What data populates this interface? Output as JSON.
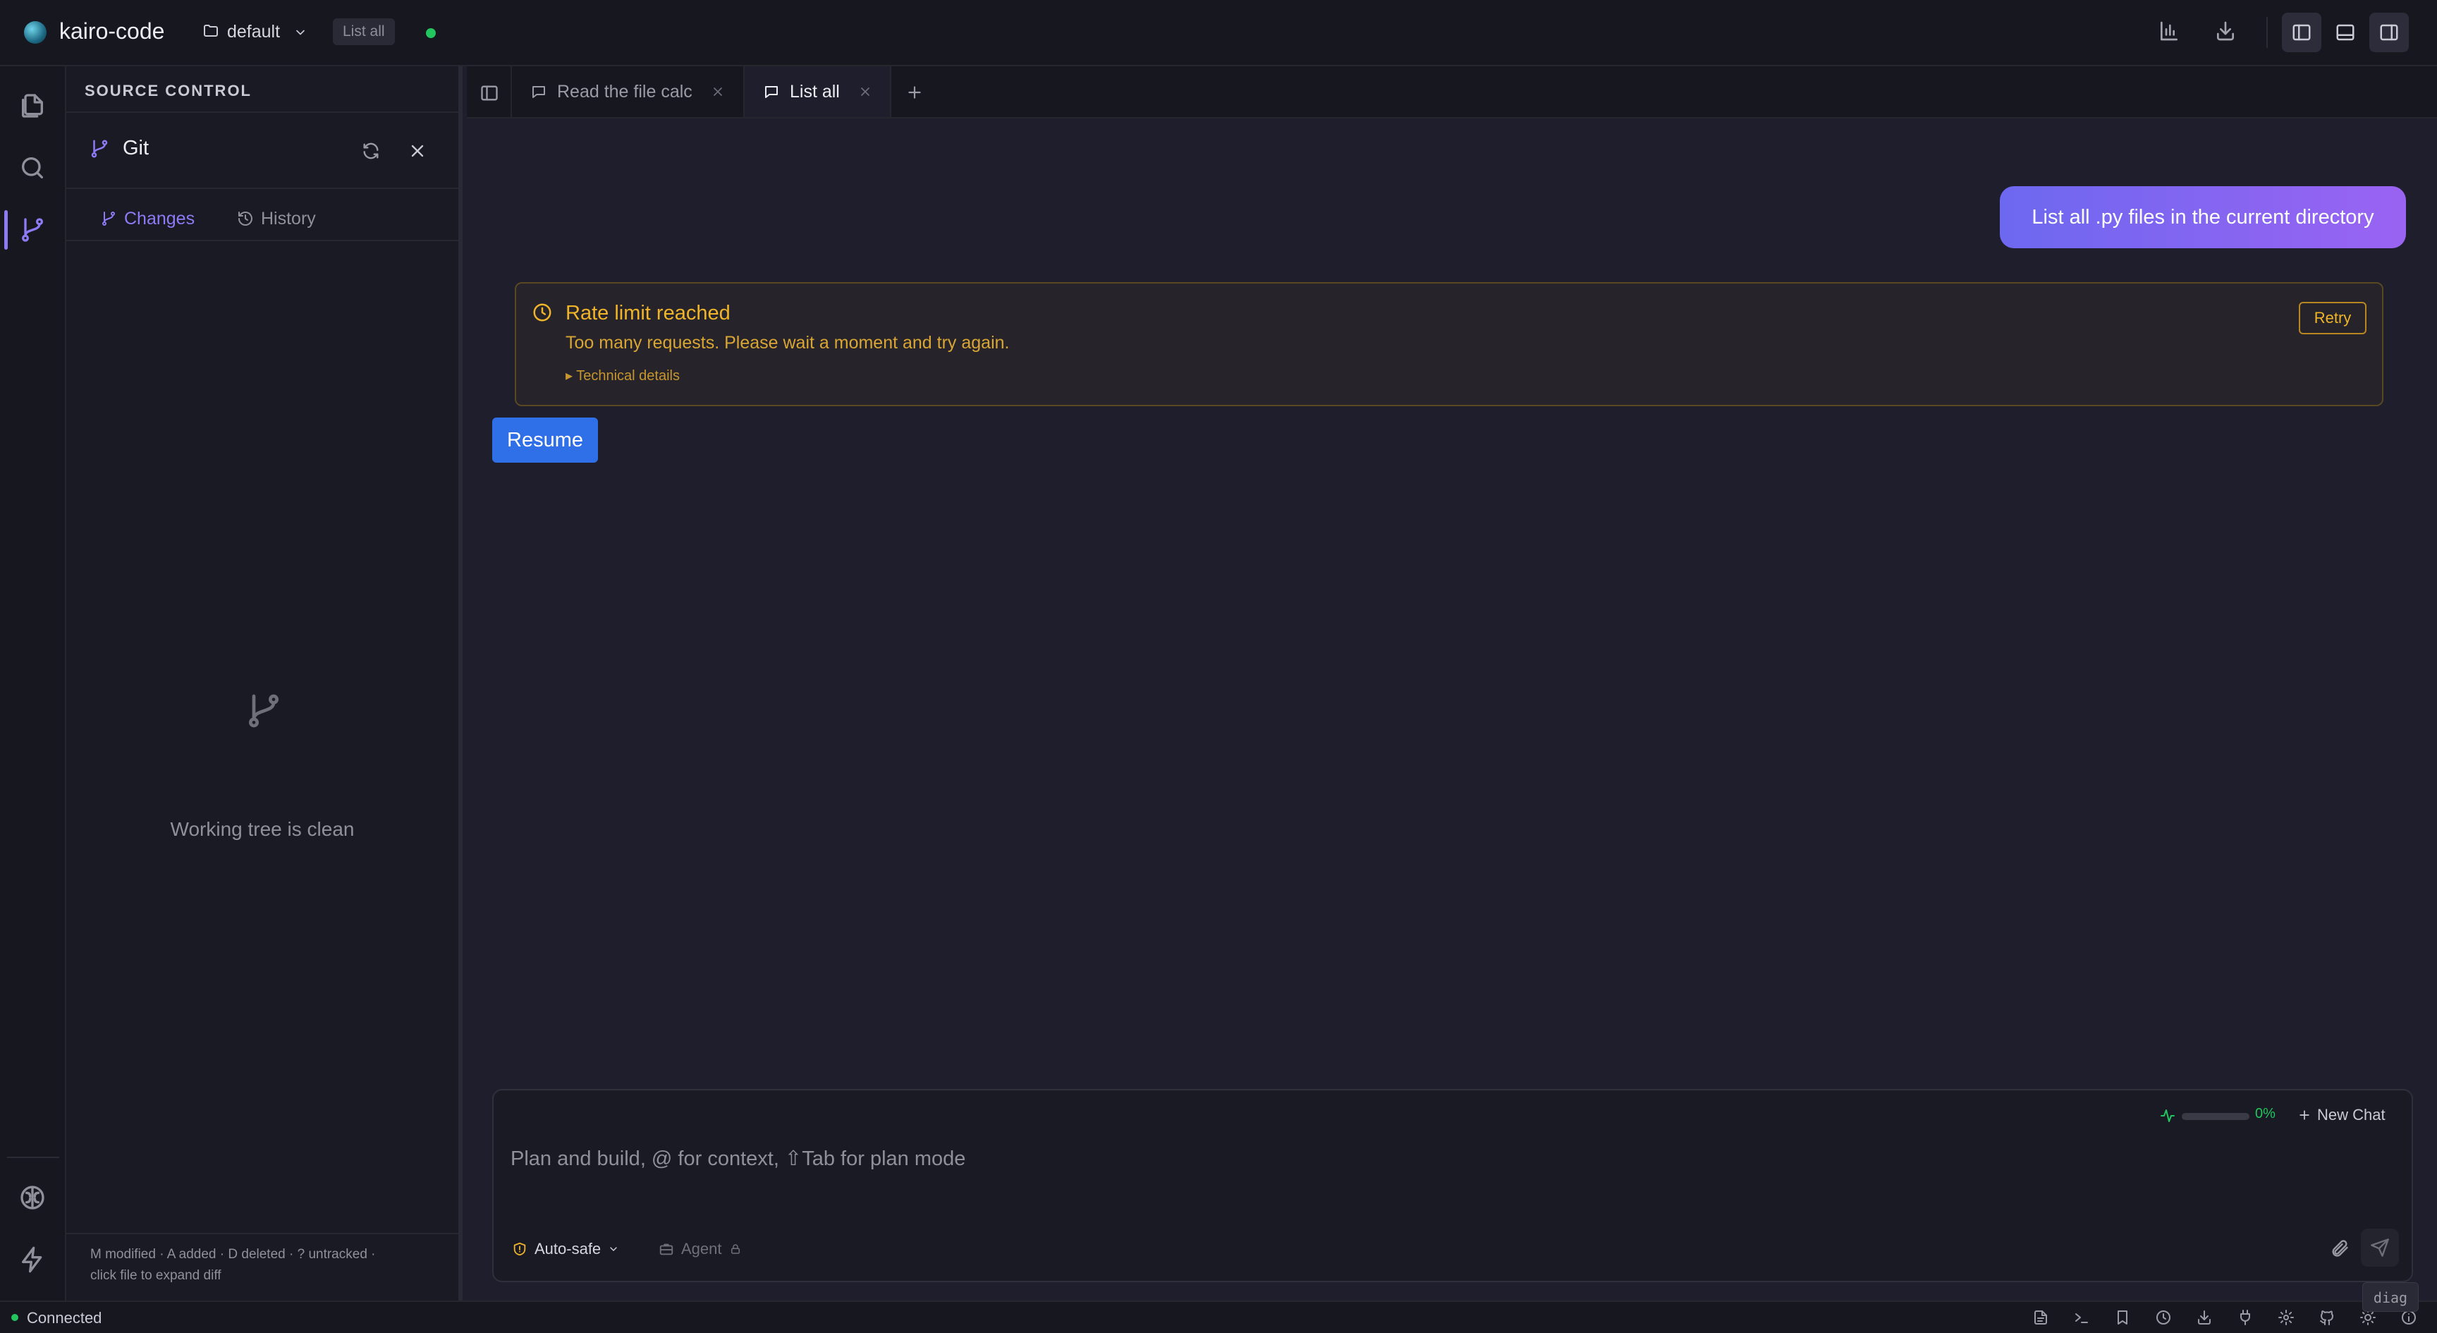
{
  "app": {
    "title": "kairo-code",
    "workspace": "default",
    "session_badge": "List all"
  },
  "scm": {
    "title": "SOURCE CONTROL",
    "provider": "Git",
    "tabs": {
      "changes": "Changes",
      "history": "History"
    },
    "empty_message": "Working tree is clean",
    "legend_line1": "M modified · A added · D deleted · ? untracked ·",
    "legend_line2": "click file to expand diff"
  },
  "tabs": [
    {
      "label": "Read the file calc",
      "active": false
    },
    {
      "label": "List all",
      "active": true
    }
  ],
  "chat": {
    "user_message": "List all .py files in the current directory",
    "error": {
      "title": "Rate limit reached",
      "message": "Too many requests. Please wait a moment and try again.",
      "details": "▸ Technical details",
      "retry": "Retry"
    },
    "resume": "Resume"
  },
  "composer": {
    "placeholder": "Plan and build, @ for context, ⇧Tab for plan mode",
    "context_percent": "0%",
    "context_fraction": 0,
    "new_chat": "New Chat",
    "mode": "Auto-safe",
    "agent": "Agent"
  },
  "status": {
    "connection": "Connected",
    "diag": "diag"
  },
  "colors": {
    "accent": "#8b7bf5",
    "warning": "#f0b429",
    "success": "#22c55e",
    "primary": "#2f6fe8"
  }
}
